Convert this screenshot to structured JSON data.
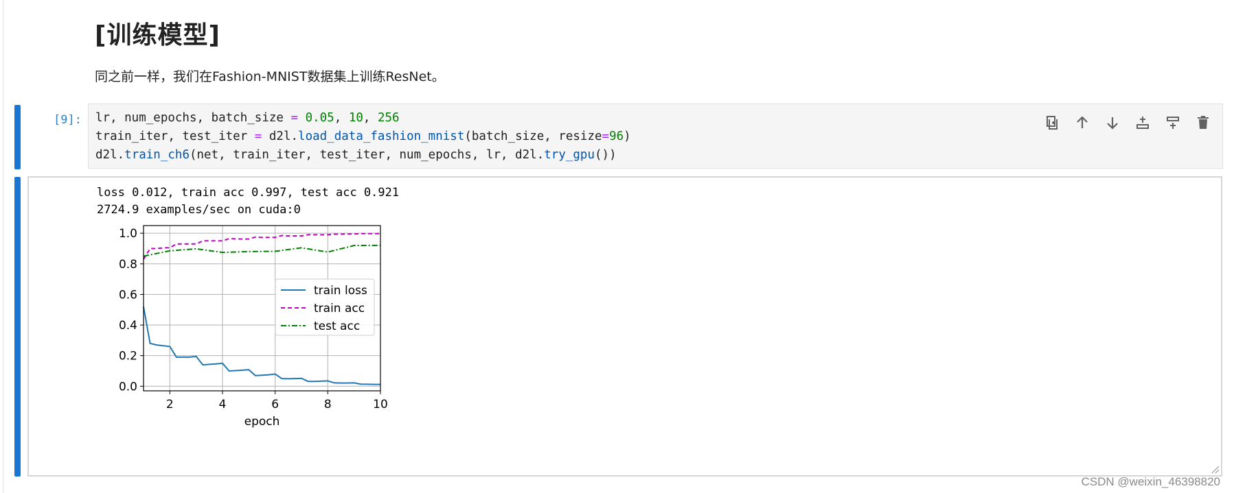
{
  "markdown": {
    "heading": "[训练模型]",
    "paragraph": "同之前一样，我们在Fashion-MNIST数据集上训练ResNet。"
  },
  "code_cell": {
    "prompt": "[9]:",
    "lines": [
      [
        {
          "t": "lr, num_epochs, batch_size ",
          "c": ""
        },
        {
          "t": "=",
          "c": "op"
        },
        {
          "t": " ",
          "c": ""
        },
        {
          "t": "0.05",
          "c": "num"
        },
        {
          "t": ", ",
          "c": ""
        },
        {
          "t": "10",
          "c": "num"
        },
        {
          "t": ", ",
          "c": ""
        },
        {
          "t": "256",
          "c": "num"
        }
      ],
      [
        {
          "t": "train_iter, test_iter ",
          "c": ""
        },
        {
          "t": "=",
          "c": "op"
        },
        {
          "t": " d2l.",
          "c": ""
        },
        {
          "t": "load_data_fashion_mnist",
          "c": "fn"
        },
        {
          "t": "(batch_size, resize",
          "c": ""
        },
        {
          "t": "=",
          "c": "op"
        },
        {
          "t": "96",
          "c": "num"
        },
        {
          "t": ")",
          "c": ""
        }
      ],
      [
        {
          "t": "d2l.",
          "c": ""
        },
        {
          "t": "train_ch6",
          "c": "fn"
        },
        {
          "t": "(net, train_iter, test_iter, num_epochs, lr, d2l.",
          "c": ""
        },
        {
          "t": "try_gpu",
          "c": "fn"
        },
        {
          "t": "())",
          "c": ""
        }
      ]
    ],
    "toolbar": [
      {
        "name": "duplicate-cell-icon",
        "label": "Duplicate cell"
      },
      {
        "name": "move-up-icon",
        "label": "Move up"
      },
      {
        "name": "move-down-icon",
        "label": "Move down"
      },
      {
        "name": "insert-above-icon",
        "label": "Insert above"
      },
      {
        "name": "insert-below-icon",
        "label": "Insert below"
      },
      {
        "name": "delete-icon",
        "label": "Delete cell"
      }
    ]
  },
  "output": {
    "line1": "loss 0.012, train acc 0.997, test acc 0.921",
    "line2": "2724.9 examples/sec on cuda:0"
  },
  "chart_data": {
    "type": "line",
    "title": "",
    "xlabel": "epoch",
    "ylabel": "",
    "xlim": [
      1,
      10
    ],
    "ylim": [
      -0.03,
      1.05
    ],
    "xticks": [
      2,
      4,
      6,
      8,
      10
    ],
    "yticks": [
      0.0,
      0.2,
      0.4,
      0.6,
      0.8,
      1.0
    ],
    "grid": true,
    "legend": "center-right",
    "series": [
      {
        "name": "train loss",
        "color": "#1f77b4",
        "dash": "solid",
        "x": [
          1.0,
          1.25,
          1.5,
          1.75,
          2.0,
          2.25,
          2.5,
          2.75,
          3.0,
          3.25,
          3.5,
          3.75,
          4.0,
          4.25,
          4.5,
          4.75,
          5.0,
          5.25,
          5.5,
          5.75,
          6.0,
          6.25,
          6.5,
          6.75,
          7.0,
          7.25,
          7.5,
          7.75,
          8.0,
          8.25,
          8.5,
          8.75,
          9.0,
          9.25,
          9.5,
          9.75,
          10.0
        ],
        "y": [
          0.52,
          0.28,
          0.27,
          0.265,
          0.26,
          0.19,
          0.19,
          0.19,
          0.195,
          0.14,
          0.143,
          0.146,
          0.15,
          0.1,
          0.102,
          0.105,
          0.108,
          0.07,
          0.072,
          0.075,
          0.08,
          0.05,
          0.049,
          0.05,
          0.052,
          0.032,
          0.032,
          0.033,
          0.035,
          0.022,
          0.021,
          0.021,
          0.022,
          0.014,
          0.013,
          0.012,
          0.012
        ]
      },
      {
        "name": "train acc",
        "color": "#bf00bf",
        "dash": "6,4",
        "x": [
          1.0,
          1.25,
          1.5,
          1.75,
          2.0,
          2.25,
          2.5,
          2.75,
          3.0,
          3.25,
          3.5,
          3.75,
          4.0,
          4.25,
          4.5,
          4.75,
          5.0,
          5.25,
          5.5,
          5.75,
          6.0,
          6.25,
          6.5,
          6.75,
          7.0,
          7.25,
          7.5,
          7.75,
          8.0,
          8.25,
          8.5,
          8.75,
          9.0,
          9.25,
          9.5,
          9.75,
          10.0
        ],
        "y": [
          0.83,
          0.9,
          0.9,
          0.905,
          0.905,
          0.93,
          0.93,
          0.93,
          0.93,
          0.95,
          0.95,
          0.95,
          0.95,
          0.965,
          0.963,
          0.962,
          0.962,
          0.975,
          0.973,
          0.973,
          0.973,
          0.985,
          0.983,
          0.983,
          0.983,
          0.99,
          0.99,
          0.99,
          0.99,
          0.994,
          0.994,
          0.995,
          0.995,
          0.997,
          0.997,
          0.997,
          0.997
        ]
      },
      {
        "name": "test acc",
        "color": "#008000",
        "dash": "8,3,2,3",
        "x": [
          1,
          2,
          3,
          4,
          5,
          6,
          7,
          8,
          9,
          10
        ],
        "y": [
          0.85,
          0.885,
          0.898,
          0.875,
          0.88,
          0.882,
          0.905,
          0.877,
          0.92,
          0.921
        ]
      }
    ]
  },
  "watermark": "CSDN @weixin_46398820"
}
